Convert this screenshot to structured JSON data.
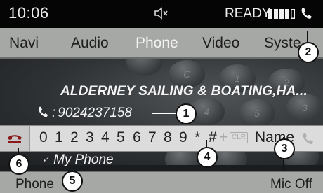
{
  "status": {
    "time": "10:06",
    "ready_text": "READY",
    "signal_bars": 5,
    "signal_level": 4,
    "mute_icon": "speaker-muted-icon",
    "phone_icon": "phone-handset-icon"
  },
  "menu": {
    "items": [
      "Navi",
      "Audio",
      "Phone",
      "Video",
      "Syste"
    ],
    "active": "Phone"
  },
  "keypad_bg": {
    "keys": [
      "C",
      "1",
      "2",
      "3",
      "4",
      "5",
      "6"
    ]
  },
  "contact": {
    "name": "ALDERNEY SAILING & BOATING,HA...",
    "colon": ":",
    "number": "9024237158"
  },
  "digits": {
    "keys": [
      "0",
      "1",
      "2",
      "3",
      "4",
      "5",
      "6",
      "7",
      "8",
      "9",
      "*",
      "#"
    ],
    "plus": "+",
    "clr": "CLR",
    "name": "Name",
    "end_call_icon": "end-call-icon",
    "dial_icon": "dial-handset-icon"
  },
  "source": {
    "check": "✓",
    "label": "My Phone"
  },
  "bottom": {
    "left": "Phone",
    "right": "Mic Off"
  },
  "callouts": [
    "1",
    "2",
    "3",
    "4",
    "5",
    "6"
  ],
  "colors": {
    "menu_bg": "#a6a8a5",
    "status_bg": "#050505",
    "digit_row_bg": "#dcdcdc",
    "text_light": "#f5f5f5"
  }
}
